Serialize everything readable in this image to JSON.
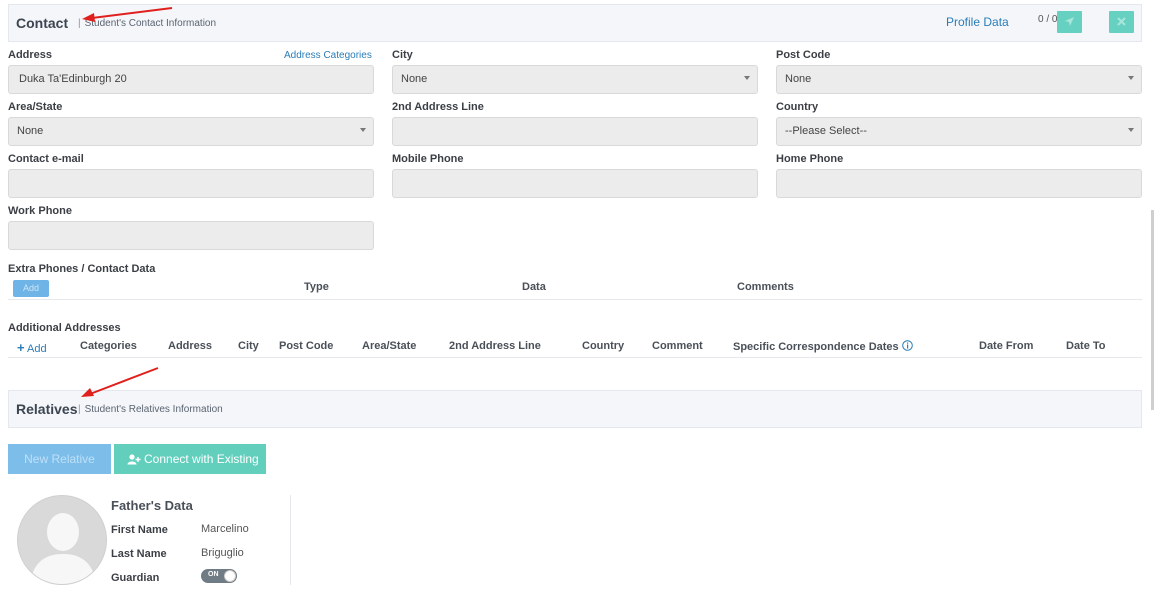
{
  "contact": {
    "title": "Contact",
    "subtitle": "Student's Contact Information",
    "profile_link": "Profile Data",
    "counter": "0 / 0"
  },
  "form": {
    "address_label": "Address",
    "address_categories_link": "Address Categories",
    "address_value": "Duka Ta'Edinburgh 20",
    "city_label": "City",
    "city_value": "None",
    "postcode_label": "Post Code",
    "postcode_value": "None",
    "area_label": "Area/State",
    "area_value": "None",
    "address2_label": "2nd Address Line",
    "address2_value": "",
    "country_label": "Country",
    "country_value": "--Please Select--",
    "email_label": "Contact e-mail",
    "mobile_label": "Mobile Phone",
    "home_label": "Home Phone",
    "work_label": "Work Phone"
  },
  "extra_phones": {
    "title": "Extra Phones / Contact Data",
    "add_label": "Add",
    "columns": [
      "Type",
      "Data",
      "Comments"
    ]
  },
  "additional_addresses": {
    "title": "Additional Addresses",
    "add_label": "Add",
    "columns": [
      "Categories",
      "Address",
      "City",
      "Post Code",
      "Area/State",
      "2nd Address Line",
      "Country",
      "Comment",
      "Specific Correspondence Dates",
      "Date From",
      "Date To"
    ]
  },
  "relatives": {
    "title": "Relatives",
    "subtitle": "Student's Relatives Information",
    "new_button": "New Relative",
    "connect_button": "Connect with Existing"
  },
  "father": {
    "title": "Father's Data",
    "first_name_label": "First Name",
    "first_name_value": "Marcelino",
    "last_name_label": "Last Name",
    "last_name_value": "Briguglio",
    "guardian_label": "Guardian",
    "guardian_toggle": "ON"
  },
  "colors": {
    "accent_teal": "#62cfbd",
    "accent_blue": "#7cbdea",
    "link_blue": "#2a7db8",
    "arrow_red": "#e0201c"
  }
}
